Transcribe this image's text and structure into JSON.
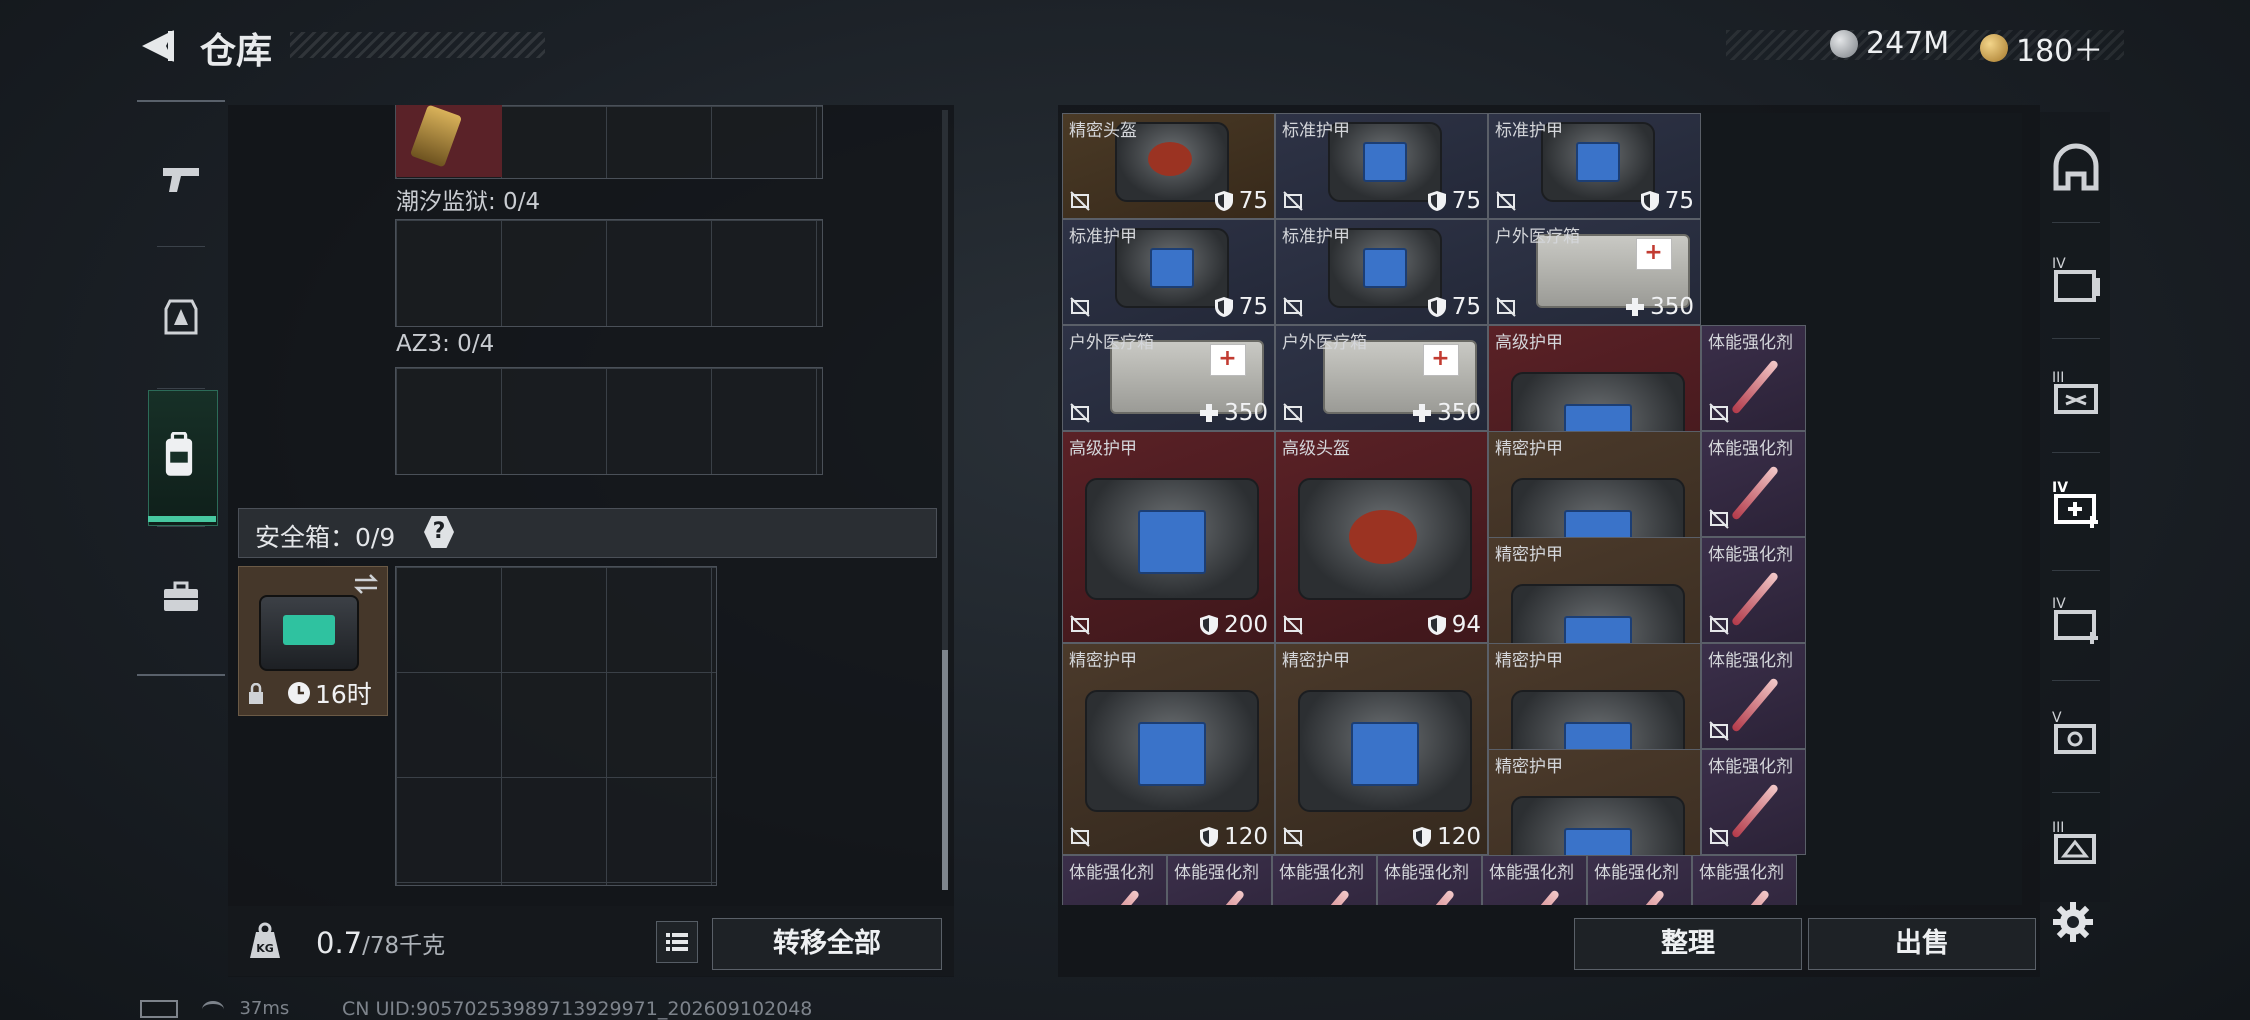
{
  "header": {
    "title": "仓库",
    "currencies": [
      {
        "icon": "silver-coin-icon",
        "value": "247M"
      },
      {
        "icon": "gold-coin-icon",
        "value": "180＋"
      }
    ]
  },
  "left_nav": {
    "items": [
      {
        "icon": "pistol-icon",
        "active": false
      },
      {
        "icon": "armor-slot-icon",
        "active": false
      },
      {
        "icon": "backpack-icon",
        "active": true
      },
      {
        "icon": "briefcase-icon",
        "active": false
      }
    ]
  },
  "left_panel": {
    "containers": [
      {
        "label": "潮汐监狱: 0/4"
      },
      {
        "label": "AZ3: 0/4"
      }
    ],
    "safebox": {
      "label": "安全箱：0/9",
      "help": "?",
      "timer": "16时"
    },
    "weight": {
      "current": "0.7",
      "max": "/78千克"
    },
    "transfer_all": "转移全部"
  },
  "items": [
    {
      "name": "精密头盔",
      "value": "75",
      "stat": "shield"
    },
    {
      "name": "标准护甲",
      "value": "75",
      "stat": "shield"
    },
    {
      "name": "标准护甲",
      "value": "75",
      "stat": "shield"
    },
    {
      "name": "标准护甲",
      "value": "75",
      "stat": "shield"
    },
    {
      "name": "标准护甲",
      "value": "75",
      "stat": "shield"
    },
    {
      "name": "户外医疗箱",
      "value": "350",
      "stat": "heal"
    },
    {
      "name": "户外医疗箱",
      "value": "350",
      "stat": "heal"
    },
    {
      "name": "户外医疗箱",
      "value": "350",
      "stat": "heal"
    },
    {
      "name": "高级护甲",
      "value": "200",
      "stat": "shield"
    },
    {
      "name": "体能强化剂",
      "value": "",
      "stat": ""
    },
    {
      "name": "高级护甲",
      "value": "200",
      "stat": "shield"
    },
    {
      "name": "高级头盔",
      "value": "94",
      "stat": "shield"
    },
    {
      "name": "精密护甲",
      "value": "120",
      "stat": "shield"
    },
    {
      "name": "体能强化剂",
      "value": "",
      "stat": ""
    },
    {
      "name": "精密护甲",
      "value": "120",
      "stat": "shield"
    },
    {
      "name": "体能强化剂",
      "value": "",
      "stat": ""
    },
    {
      "name": "精密护甲",
      "value": "120",
      "stat": "shield"
    },
    {
      "name": "精密护甲",
      "value": "120",
      "stat": "shield"
    },
    {
      "name": "精密护甲",
      "value": "120",
      "stat": "shield"
    },
    {
      "name": "体能强化剂",
      "value": "",
      "stat": ""
    },
    {
      "name": "精密护甲",
      "value": "",
      "stat": ""
    },
    {
      "name": "体能强化剂",
      "value": "",
      "stat": ""
    },
    {
      "name": "体能强化剂",
      "value": "",
      "stat": ""
    },
    {
      "name": "体能强化剂",
      "value": "",
      "stat": ""
    },
    {
      "name": "体能强化剂",
      "value": "",
      "stat": ""
    },
    {
      "name": "体能强化剂",
      "value": "",
      "stat": ""
    },
    {
      "name": "体能强化剂",
      "value": "",
      "stat": ""
    },
    {
      "name": "体能强化剂",
      "value": "",
      "stat": ""
    },
    {
      "name": "体能强化剂",
      "value": "",
      "stat": ""
    }
  ],
  "right_buttons": {
    "sort": "整理",
    "sell": "出售"
  },
  "right_nav": {
    "labels": [
      "IV",
      "III",
      "IV",
      "IV",
      "V",
      "III"
    ]
  },
  "status_bar": {
    "ping": "37ms",
    "uid": "CN UID:9057025398971392997​1_202609102048"
  }
}
